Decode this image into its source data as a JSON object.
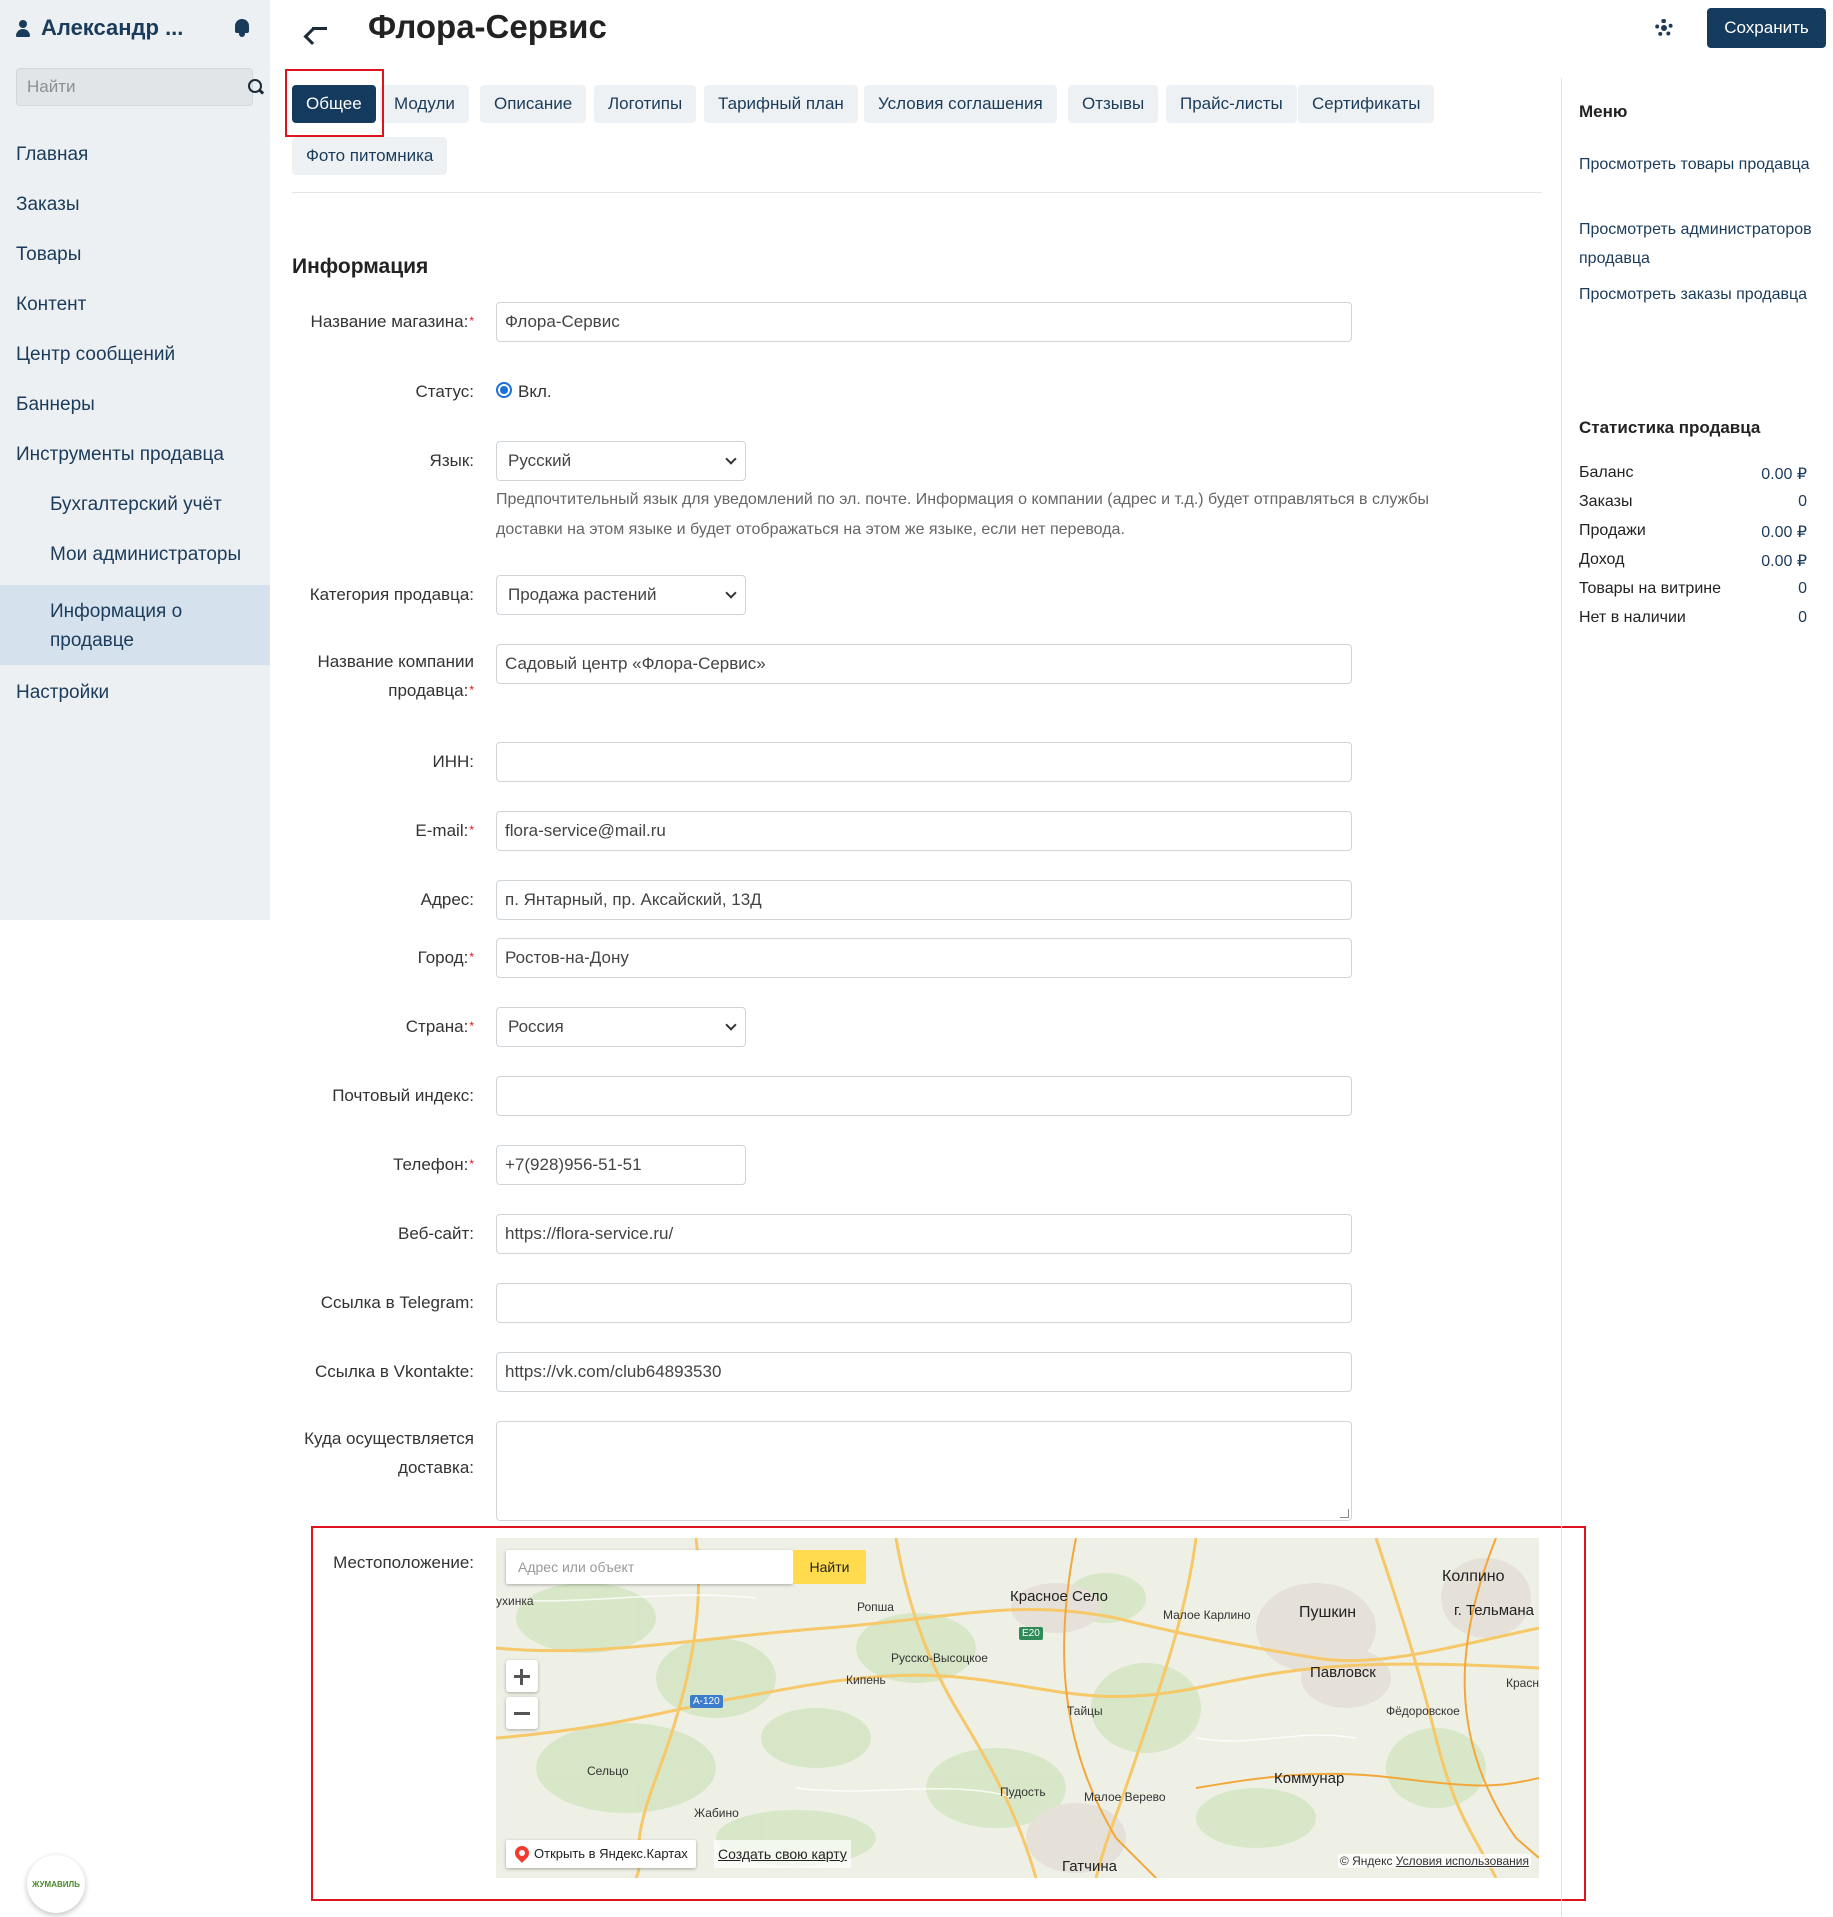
{
  "sidebar": {
    "user_name": "Александр ...",
    "search_placeholder": "Найти",
    "items": [
      {
        "label": "Главная"
      },
      {
        "label": "Заказы"
      },
      {
        "label": "Товары"
      },
      {
        "label": "Контент"
      },
      {
        "label": "Центр сообщений"
      },
      {
        "label": "Баннеры"
      },
      {
        "label": "Инструменты продавца"
      },
      {
        "label": "Бухгалтерский учёт"
      },
      {
        "label": "Мои администраторы"
      },
      {
        "label": "Информация о продавце"
      },
      {
        "label": "Настройки"
      }
    ],
    "logo_text": "ЖУМАВИЛЬ"
  },
  "header": {
    "title": "Флора-Сервис",
    "save_label": "Сохранить"
  },
  "tabs": [
    {
      "label": "Общее"
    },
    {
      "label": "Модули"
    },
    {
      "label": "Описание"
    },
    {
      "label": "Логотипы"
    },
    {
      "label": "Тарифный план"
    },
    {
      "label": "Условия соглашения"
    },
    {
      "label": "Отзывы"
    },
    {
      "label": "Прайс-листы"
    },
    {
      "label": "Сертификаты"
    },
    {
      "label": "Фото питомника"
    }
  ],
  "form": {
    "section_title": "Информация",
    "shop_name": {
      "label": "Название магазина:",
      "value": "Флора-Сервис"
    },
    "status": {
      "label": "Статус:",
      "value": "Вкл."
    },
    "language": {
      "label": "Язык:",
      "value": "Русский",
      "help": "Предпочтительный язык для уведомлений по эл. почте. Информация о компании (адрес и т.д.) будет отправляться в службы доставки на этом языке и будет отображаться на этом же языке, если нет перевода."
    },
    "category": {
      "label": "Категория продавца:",
      "value": "Продажа растений"
    },
    "company_name": {
      "label": "Название компании продавца:",
      "value": "Садовый центр «Флора-Сервис»"
    },
    "inn": {
      "label": "ИНН:",
      "value": ""
    },
    "email": {
      "label": "E-mail:",
      "value": "flora-service@mail.ru"
    },
    "address": {
      "label": "Адрес:",
      "value": "п. Янтарный, пр. Аксайский, 13Д"
    },
    "city": {
      "label": "Город:",
      "value": "Ростов-на-Дону"
    },
    "country": {
      "label": "Страна:",
      "value": "Россия"
    },
    "zip": {
      "label": "Почтовый индекс:",
      "value": ""
    },
    "phone": {
      "label": "Телефон:",
      "value": "+7(928)956-51-51"
    },
    "website": {
      "label": "Веб-сайт:",
      "value": "https://flora-service.ru/"
    },
    "telegram": {
      "label": "Ссылка в Telegram:",
      "value": ""
    },
    "vk": {
      "label": "Ссылка в Vkontakte:",
      "value": "https://vk.com/club64893530"
    },
    "delivery": {
      "label": "Куда осуществляется доставка:",
      "value": ""
    },
    "location": {
      "label": "Местоположение:"
    }
  },
  "map": {
    "search_placeholder": "Адрес или объект",
    "find_label": "Найти",
    "open_label": "Открыть в Яндекс.Картах",
    "create_label": "Создать свою карту",
    "copyright": "© Яндекс",
    "terms": "Условия использования",
    "places": [
      {
        "name": "Колпино"
      },
      {
        "name": "г. Тельмана"
      },
      {
        "name": "Красное Село"
      },
      {
        "name": "Малое Карлино"
      },
      {
        "name": "Пушкин"
      },
      {
        "name": "Ропша"
      },
      {
        "name": "Русско-Высоцкое"
      },
      {
        "name": "Кипень"
      },
      {
        "name": "Павловск"
      },
      {
        "name": "Тайцы"
      },
      {
        "name": "Фёдоровское"
      },
      {
        "name": "Сельцо"
      },
      {
        "name": "Коммунар"
      },
      {
        "name": "Пудость"
      },
      {
        "name": "Малое Верево"
      },
      {
        "name": "Жабино"
      },
      {
        "name": "Гатчина"
      },
      {
        "name": "ухинка"
      },
      {
        "name": "Красн"
      }
    ],
    "roads": [
      {
        "name": "А-120"
      },
      {
        "name": "E20"
      }
    ]
  },
  "right_panel": {
    "menu_title": "Меню",
    "links": [
      {
        "label": "Просмотреть товары продавца"
      },
      {
        "label": "Просмотреть администраторов продавца"
      },
      {
        "label": "Просмотреть заказы продавца"
      }
    ],
    "stats_title": "Статистика продавца",
    "stats": [
      {
        "label": "Баланс",
        "value": "0.00 ₽"
      },
      {
        "label": "Заказы",
        "value": "0"
      },
      {
        "label": "Продажи",
        "value": "0.00 ₽"
      },
      {
        "label": "Доход",
        "value": "0.00 ₽"
      },
      {
        "label": "Товары на витрине",
        "value": "0"
      },
      {
        "label": "Нет в наличии",
        "value": "0"
      }
    ]
  },
  "colors": {
    "primary": "#143a5e",
    "highlight": "#e0141f",
    "required": "#e0141f",
    "map_find": "#ffdb4d"
  }
}
